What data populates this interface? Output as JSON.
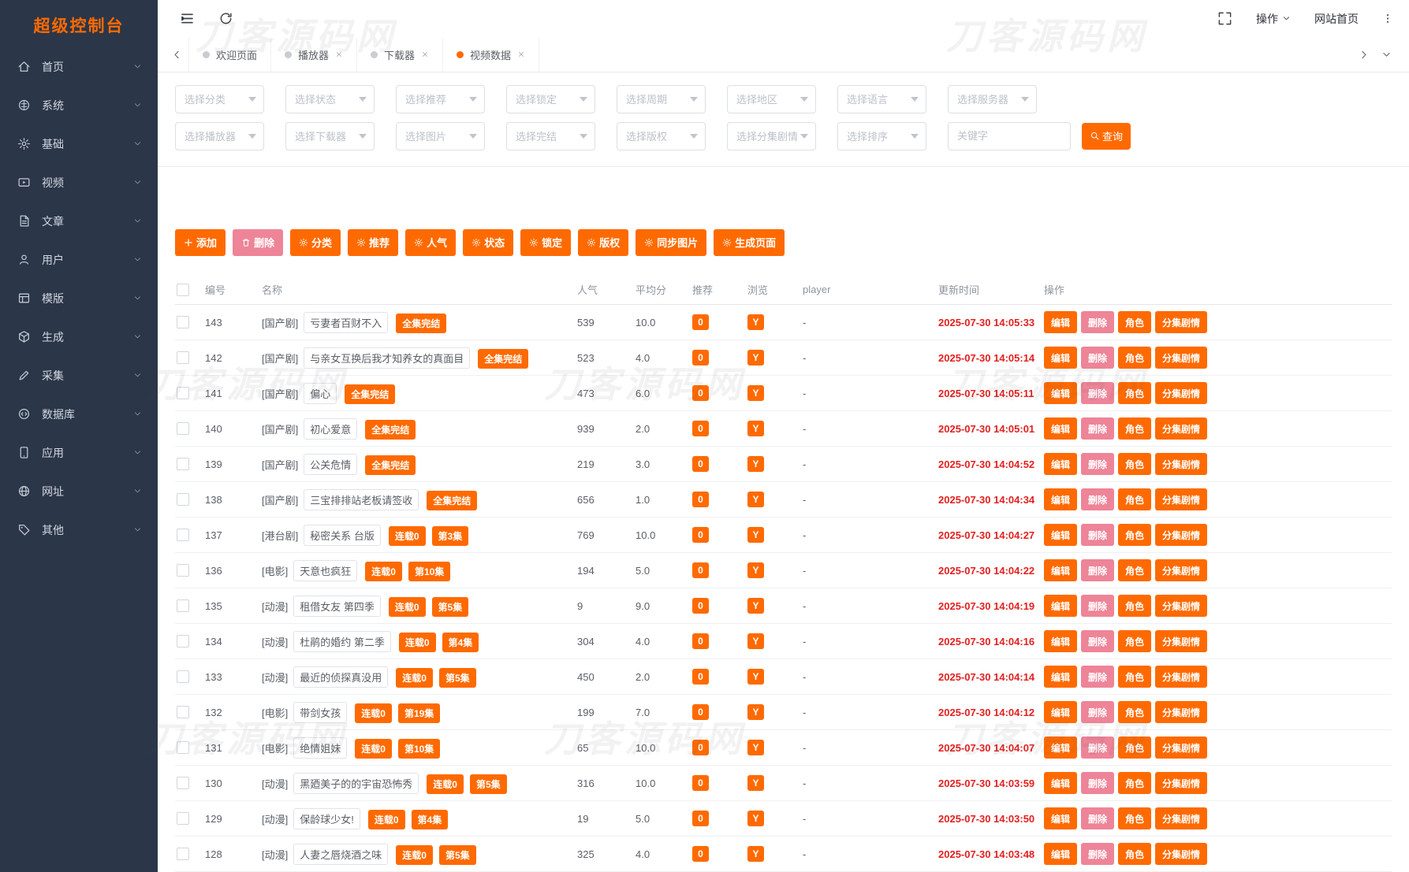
{
  "app": {
    "title": "超级控制台",
    "watermark_text": "刀客源码网"
  },
  "colors": {
    "accent": "#ff6a00",
    "delete_pink": "#ee8498",
    "time_red": "#e32020",
    "sidebar_bg": "#2b3648"
  },
  "sidebar": {
    "items": [
      {
        "label": "首页",
        "icon": "home"
      },
      {
        "label": "系统",
        "icon": "system"
      },
      {
        "label": "基础",
        "icon": "gear"
      },
      {
        "label": "视频",
        "icon": "video"
      },
      {
        "label": "文章",
        "icon": "article"
      },
      {
        "label": "用户",
        "icon": "user"
      },
      {
        "label": "模版",
        "icon": "template"
      },
      {
        "label": "生成",
        "icon": "cube"
      },
      {
        "label": "采集",
        "icon": "pen"
      },
      {
        "label": "数据库",
        "icon": "database"
      },
      {
        "label": "应用",
        "icon": "tablet"
      },
      {
        "label": "网址",
        "icon": "globe"
      },
      {
        "label": "其他",
        "icon": "tag"
      }
    ]
  },
  "topbar": {
    "actions_label": "操作",
    "home_link": "网站首页"
  },
  "tabs": [
    {
      "label": "欢迎页面",
      "closable": false,
      "active": false
    },
    {
      "label": "播放器",
      "closable": true,
      "active": false
    },
    {
      "label": "下载器",
      "closable": true,
      "active": false
    },
    {
      "label": "视频数据",
      "closable": true,
      "active": true
    }
  ],
  "filters": {
    "row1": [
      "选择分类",
      "选择状态",
      "选择推荐",
      "选择锁定",
      "选择周期",
      "选择地区",
      "选择语言",
      "选择服务器"
    ],
    "row2": [
      "选择播放器",
      "选择下载器",
      "选择图片",
      "选择完结",
      "选择版权",
      "选择分集剧情",
      "选择排序"
    ],
    "keyword_placeholder": "关键字",
    "search_label": "查询"
  },
  "toolbar": {
    "buttons": [
      {
        "label": "添加",
        "icon": "plus",
        "style": "orange"
      },
      {
        "label": "删除",
        "icon": "trash",
        "style": "pink"
      },
      {
        "label": "分类",
        "icon": "gear",
        "style": "orange"
      },
      {
        "label": "推荐",
        "icon": "gear",
        "style": "orange"
      },
      {
        "label": "人气",
        "icon": "gear",
        "style": "orange"
      },
      {
        "label": "状态",
        "icon": "gear",
        "style": "orange"
      },
      {
        "label": "锁定",
        "icon": "gear",
        "style": "orange"
      },
      {
        "label": "版权",
        "icon": "gear",
        "style": "orange"
      },
      {
        "label": "同步图片",
        "icon": "gear",
        "style": "orange"
      },
      {
        "label": "生成页面",
        "icon": "gear",
        "style": "orange"
      }
    ]
  },
  "table": {
    "headers": [
      "编号",
      "名称",
      "人气",
      "平均分",
      "推荐",
      "浏览",
      "player",
      "更新时间",
      "操作"
    ],
    "row_actions": [
      {
        "label": "编辑",
        "style": "orange"
      },
      {
        "label": "删除",
        "style": "pink"
      },
      {
        "label": "角色",
        "style": "orange"
      },
      {
        "label": "分集剧情",
        "style": "orange"
      }
    ],
    "rows": [
      {
        "id": "143",
        "category": "[国产剧]",
        "title": "亏妻者百财不入",
        "status_tags": [
          "全集完结"
        ],
        "popularity": "539",
        "avg_score": "10.0",
        "recommend": "0",
        "view": "Y",
        "player": "-",
        "updated": "2025-07-30 14:05:33"
      },
      {
        "id": "142",
        "category": "[国产剧]",
        "title": "与亲女互换后我才知养女的真面目",
        "status_tags": [
          "全集完结"
        ],
        "popularity": "523",
        "avg_score": "4.0",
        "recommend": "0",
        "view": "Y",
        "player": "-",
        "updated": "2025-07-30 14:05:14"
      },
      {
        "id": "141",
        "category": "[国产剧]",
        "title": "偏心",
        "status_tags": [
          "全集完结"
        ],
        "popularity": "473",
        "avg_score": "6.0",
        "recommend": "0",
        "view": "Y",
        "player": "-",
        "updated": "2025-07-30 14:05:11"
      },
      {
        "id": "140",
        "category": "[国产剧]",
        "title": "初心爱意",
        "status_tags": [
          "全集完结"
        ],
        "popularity": "939",
        "avg_score": "2.0",
        "recommend": "0",
        "view": "Y",
        "player": "-",
        "updated": "2025-07-30 14:05:01"
      },
      {
        "id": "139",
        "category": "[国产剧]",
        "title": "公关危情",
        "status_tags": [
          "全集完结"
        ],
        "popularity": "219",
        "avg_score": "3.0",
        "recommend": "0",
        "view": "Y",
        "player": "-",
        "updated": "2025-07-30 14:04:52"
      },
      {
        "id": "138",
        "category": "[国产剧]",
        "title": "三宝排排站老板请签收",
        "status_tags": [
          "全集完结"
        ],
        "popularity": "656",
        "avg_score": "1.0",
        "recommend": "0",
        "view": "Y",
        "player": "-",
        "updated": "2025-07-30 14:04:34"
      },
      {
        "id": "137",
        "category": "[港台剧]",
        "title": "秘密关系 台版",
        "status_tags": [
          "连载0",
          "第3集"
        ],
        "popularity": "769",
        "avg_score": "10.0",
        "recommend": "0",
        "view": "Y",
        "player": "-",
        "updated": "2025-07-30 14:04:27"
      },
      {
        "id": "136",
        "category": "[电影]",
        "title": "天意也疯狂",
        "status_tags": [
          "连载0",
          "第10集"
        ],
        "popularity": "194",
        "avg_score": "5.0",
        "recommend": "0",
        "view": "Y",
        "player": "-",
        "updated": "2025-07-30 14:04:22"
      },
      {
        "id": "135",
        "category": "[动漫]",
        "title": "租借女友 第四季",
        "status_tags": [
          "连载0",
          "第5集"
        ],
        "popularity": "9",
        "avg_score": "9.0",
        "recommend": "0",
        "view": "Y",
        "player": "-",
        "updated": "2025-07-30 14:04:19"
      },
      {
        "id": "134",
        "category": "[动漫]",
        "title": "杜鹃的婚约 第二季",
        "status_tags": [
          "连载0",
          "第4集"
        ],
        "popularity": "304",
        "avg_score": "4.0",
        "recommend": "0",
        "view": "Y",
        "player": "-",
        "updated": "2025-07-30 14:04:16"
      },
      {
        "id": "133",
        "category": "[动漫]",
        "title": "最近的侦探真没用",
        "status_tags": [
          "连载0",
          "第5集"
        ],
        "popularity": "450",
        "avg_score": "2.0",
        "recommend": "0",
        "view": "Y",
        "player": "-",
        "updated": "2025-07-30 14:04:14"
      },
      {
        "id": "132",
        "category": "[电影]",
        "title": "带剑女孩",
        "status_tags": [
          "连载0",
          "第19集"
        ],
        "popularity": "199",
        "avg_score": "7.0",
        "recommend": "0",
        "view": "Y",
        "player": "-",
        "updated": "2025-07-30 14:04:12"
      },
      {
        "id": "131",
        "category": "[电影]",
        "title": "绝情姐妹",
        "status_tags": [
          "连载0",
          "第10集"
        ],
        "popularity": "65",
        "avg_score": "10.0",
        "recommend": "0",
        "view": "Y",
        "player": "-",
        "updated": "2025-07-30 14:04:07"
      },
      {
        "id": "130",
        "category": "[动漫]",
        "title": "黑廼美子的的宇宙恐怖秀",
        "status_tags": [
          "连载0",
          "第5集"
        ],
        "popularity": "316",
        "avg_score": "10.0",
        "recommend": "0",
        "view": "Y",
        "player": "-",
        "updated": "2025-07-30 14:03:59"
      },
      {
        "id": "129",
        "category": "[动漫]",
        "title": "保龄球少女!",
        "status_tags": [
          "连载0",
          "第4集"
        ],
        "popularity": "19",
        "avg_score": "5.0",
        "recommend": "0",
        "view": "Y",
        "player": "-",
        "updated": "2025-07-30 14:03:50"
      },
      {
        "id": "128",
        "category": "[动漫]",
        "title": "人妻之唇烧酒之味",
        "status_tags": [
          "连载0",
          "第5集"
        ],
        "popularity": "325",
        "avg_score": "4.0",
        "recommend": "0",
        "view": "Y",
        "player": "-",
        "updated": "2025-07-30 14:03:48"
      }
    ]
  }
}
